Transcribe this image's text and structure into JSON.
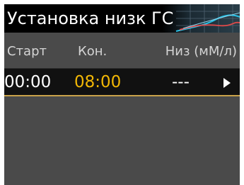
{
  "screen": {
    "title": "Установка низк ГС"
  },
  "table": {
    "headers": {
      "start": "Старт",
      "end": "Кон.",
      "low": "Низ (мМ/л)"
    },
    "rows": [
      {
        "start": "00:00",
        "end": "08:00",
        "low": "---",
        "selected": true
      }
    ]
  },
  "colors": {
    "title_background": "#000000",
    "screen_background": "#4a4a4a",
    "row_background": "#111111",
    "highlight_value": "#f2b705",
    "selection_border": "#c9a24a"
  },
  "icons": {
    "title_decoration": "wave-graph-icon",
    "row_action": "right-arrow-icon"
  }
}
